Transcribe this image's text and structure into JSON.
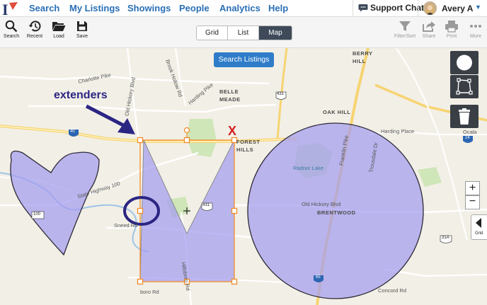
{
  "nav": {
    "items": [
      "Search",
      "My Listings",
      "Showings",
      "People",
      "Analytics",
      "Help"
    ],
    "support_label": "Support Chat",
    "user_name": "Avery A"
  },
  "toolbar": {
    "search_label": "Search",
    "recent_label": "Recent",
    "load_label": "Load",
    "save_label": "Save",
    "filter_label": "Filter/Sort",
    "share_label": "Share",
    "print_label": "Print",
    "more_label": "More"
  },
  "view_toggle": {
    "options": [
      "Grid",
      "List",
      "Map"
    ],
    "selected": "Map"
  },
  "map": {
    "search_button": "Search Listings",
    "grid_tab_label": "Grid",
    "zoom_in": "+",
    "zoom_out": "−",
    "annotation": "extenders",
    "annotation_mark": "X",
    "labels": {
      "charlotte_pike": "Charlotte Pike",
      "old_hickory_blvd_n": "Old Hickory Blvd",
      "brook_hollow": "Brook Hollow Rd",
      "harding_pike": "Harding Pike",
      "belle_meade": "BELLE\nMEADE",
      "forest_hills": "FOREST\nHILLS",
      "berry_hill": "BERRY\nHILL",
      "oak_hill": "OAK HILL",
      "harding_pl": "Harding Place",
      "ocala": "Ocala",
      "radnor_lake": "Radnor Lake",
      "old_hickory_blvd_s": "Old Hickory Blvd",
      "brentwood": "BRENTWOOD",
      "franklin_pike": "Franklin Pike",
      "trousdale": "Trousdale Dr",
      "concord": "Concord Rd",
      "state_hwy": "State Highway 100",
      "sneed": "Sneed Rd",
      "hillsboro": "Hillsboro Rd",
      "boro_rd": "boro Rd",
      "shield_40": "40",
      "shield_431a": "431",
      "shield_431b": "431",
      "shield_24": "24",
      "shield_100": "100",
      "shield_31a": "31A",
      "shield_65": "65"
    }
  },
  "colors": {
    "nav_link": "#2a6fb5",
    "active_toggle": "#3e4a5a",
    "search_button": "#2f7cc9",
    "shape_fill": "#a39cf0",
    "shape_stroke": "#2d2a36",
    "edit_handles": "#f08c28",
    "annotation": "#2b2583",
    "delete_mark": "#d42020",
    "map_tool_bg": "#3a3f46"
  }
}
